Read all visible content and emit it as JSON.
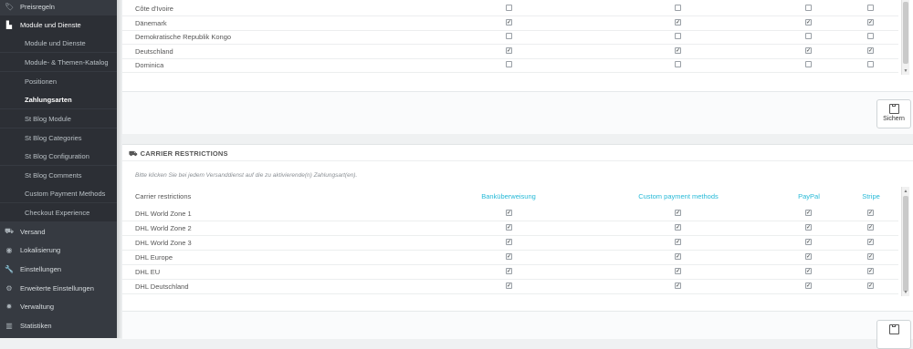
{
  "sidebar": {
    "items": [
      {
        "label": "Preisregeln",
        "icon": "tag-icon",
        "type": "main"
      },
      {
        "label": "Module und Dienste",
        "icon": "puzzle-icon",
        "type": "main-active"
      },
      {
        "label": "Module und Dienste",
        "type": "sub"
      },
      {
        "label": "Module- & Themen-Katalog",
        "type": "sub"
      },
      {
        "label": "Positionen",
        "type": "sub"
      },
      {
        "label": "Zahlungsarten",
        "type": "sub-current"
      },
      {
        "label": "St Blog Module",
        "type": "sub"
      },
      {
        "label": "St Blog Categories",
        "type": "sub"
      },
      {
        "label": "St Blog Configuration",
        "type": "sub"
      },
      {
        "label": "St Blog Comments",
        "type": "sub"
      },
      {
        "label": "Custom Payment Methods",
        "type": "sub"
      },
      {
        "label": "Checkout Experience",
        "type": "sub"
      },
      {
        "label": "Versand",
        "icon": "truck-icon",
        "type": "main"
      },
      {
        "label": "Lokalisierung",
        "icon": "globe-icon",
        "type": "main"
      },
      {
        "label": "Einstellungen",
        "icon": "wrench-icon",
        "type": "main"
      },
      {
        "label": "Erweiterte Einstellungen",
        "icon": "cogs-icon",
        "type": "main"
      },
      {
        "label": "Verwaltung",
        "icon": "gear-icon",
        "type": "main"
      },
      {
        "label": "Statistiken",
        "icon": "bar-chart-icon",
        "type": "main"
      }
    ]
  },
  "country_panel": {
    "rows": [
      {
        "name": "Côte d'Ivoire",
        "checks": [
          false,
          false,
          false,
          false
        ]
      },
      {
        "name": "Dänemark",
        "checks": [
          true,
          true,
          true,
          true
        ]
      },
      {
        "name": "Demokratische Republik Kongo",
        "checks": [
          false,
          false,
          false,
          false
        ]
      },
      {
        "name": "Deutschland",
        "checks": [
          true,
          true,
          true,
          true
        ]
      },
      {
        "name": "Dominica",
        "checks": [
          false,
          false,
          false,
          false
        ]
      }
    ],
    "save_label": "Sichern"
  },
  "carrier_panel": {
    "title": "CARRIER RESTRICTIONS",
    "hint": "Bitte klicken Sie bei jedem Versanddienst auf die zu aktivierende(n) Zahlungsart(en).",
    "row_header": "Carrier restrictions",
    "columns": [
      "Banküberweisung",
      "Custom payment methods",
      "PayPal",
      "Stripe"
    ],
    "rows": [
      {
        "name": "DHL World Zone 1",
        "checks": [
          true,
          true,
          true,
          true
        ]
      },
      {
        "name": "DHL World Zone 2",
        "checks": [
          true,
          true,
          true,
          true
        ]
      },
      {
        "name": "DHL World Zone 3",
        "checks": [
          true,
          true,
          true,
          true
        ]
      },
      {
        "name": "DHL Europe",
        "checks": [
          true,
          true,
          true,
          true
        ]
      },
      {
        "name": "DHL EU",
        "checks": [
          true,
          true,
          true,
          true
        ]
      },
      {
        "name": "DHL Deutschland",
        "checks": [
          true,
          true,
          true,
          true
        ]
      }
    ]
  }
}
